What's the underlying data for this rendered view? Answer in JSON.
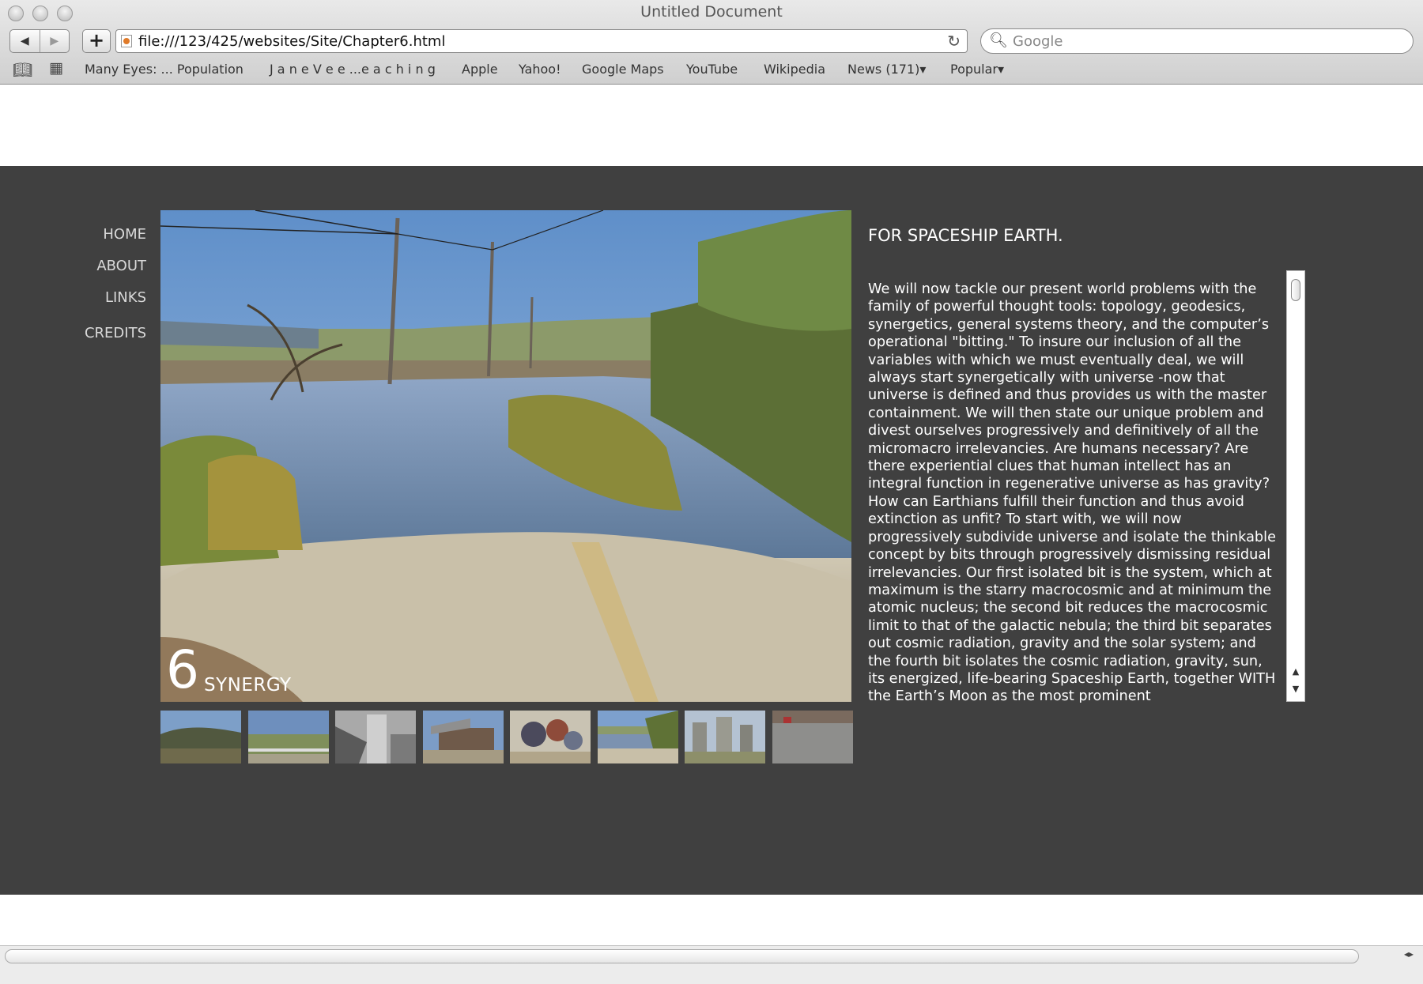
{
  "browser": {
    "title": "Untitled Document",
    "url": "file:///123/425/websites/Site/Chapter6.html",
    "search_placeholder": "Google",
    "back_label": "◀",
    "forward_label": "▶",
    "add_label": "+",
    "reload_label": "↻",
    "bookmarks": [
      "Many Eyes: ... Population",
      "J a n e V e e ...e a c h i n g",
      "Apple",
      "Yahoo!",
      "Google Maps",
      "YouTube",
      "Wikipedia",
      "News (171)▾",
      "Popular▾"
    ]
  },
  "site": {
    "nav": [
      "HOME",
      "ABOUT",
      "LINKS",
      "CREDITS"
    ],
    "chapter_number": "6",
    "chapter_title": "SYNERGY",
    "heading": "FOR SPACESHIP EARTH.",
    "body": "We will now tackle our present world problems with the family of powerful thought tools: topology, geodesics, synergetics, general systems theory, and the computer’s operational \"bitting.\" To insure our inclusion of all the variables with which we must eventually deal, we will always start synergetically with universe -now that universe is defined and thus provides us with the master containment. We will then state our unique problem and divest ourselves progressively and definitively of all the micromacro irrelevancies. Are humans necessary? Are there experiential clues that human intellect has an integral function in regenerative universe as has gravity? How can Earthians fulfill their function and thus avoid extinction as unfit? To start with, we will now progressively subdivide universe and isolate the thinkable concept by bits through progressively dismissing residual irrelevancies. Our first isolated bit is the system, which at maximum is the starry macrocosmic and at minimum the atomic nucleus; the second bit reduces the macrocosmic limit to that of the galactic nebula; the third bit separates out cosmic radiation, gravity and the solar system; and the fourth bit isolates the cosmic radiation, gravity, sun, its energized, life-bearing Spaceship Earth, together WITH the Earth’s Moon as the most prominent",
    "thumbnails": [
      "hills-landscape-photo",
      "fenced-field-photo",
      "industrial-tower-photo",
      "building-photo",
      "debris-pile-photo",
      "flooded-road-photo",
      "concrete-structure-photo",
      "parking-lot-photo"
    ]
  },
  "colors": {
    "band": "#404040",
    "text": "#ffffff",
    "nav_text": "#d9d9d9"
  }
}
